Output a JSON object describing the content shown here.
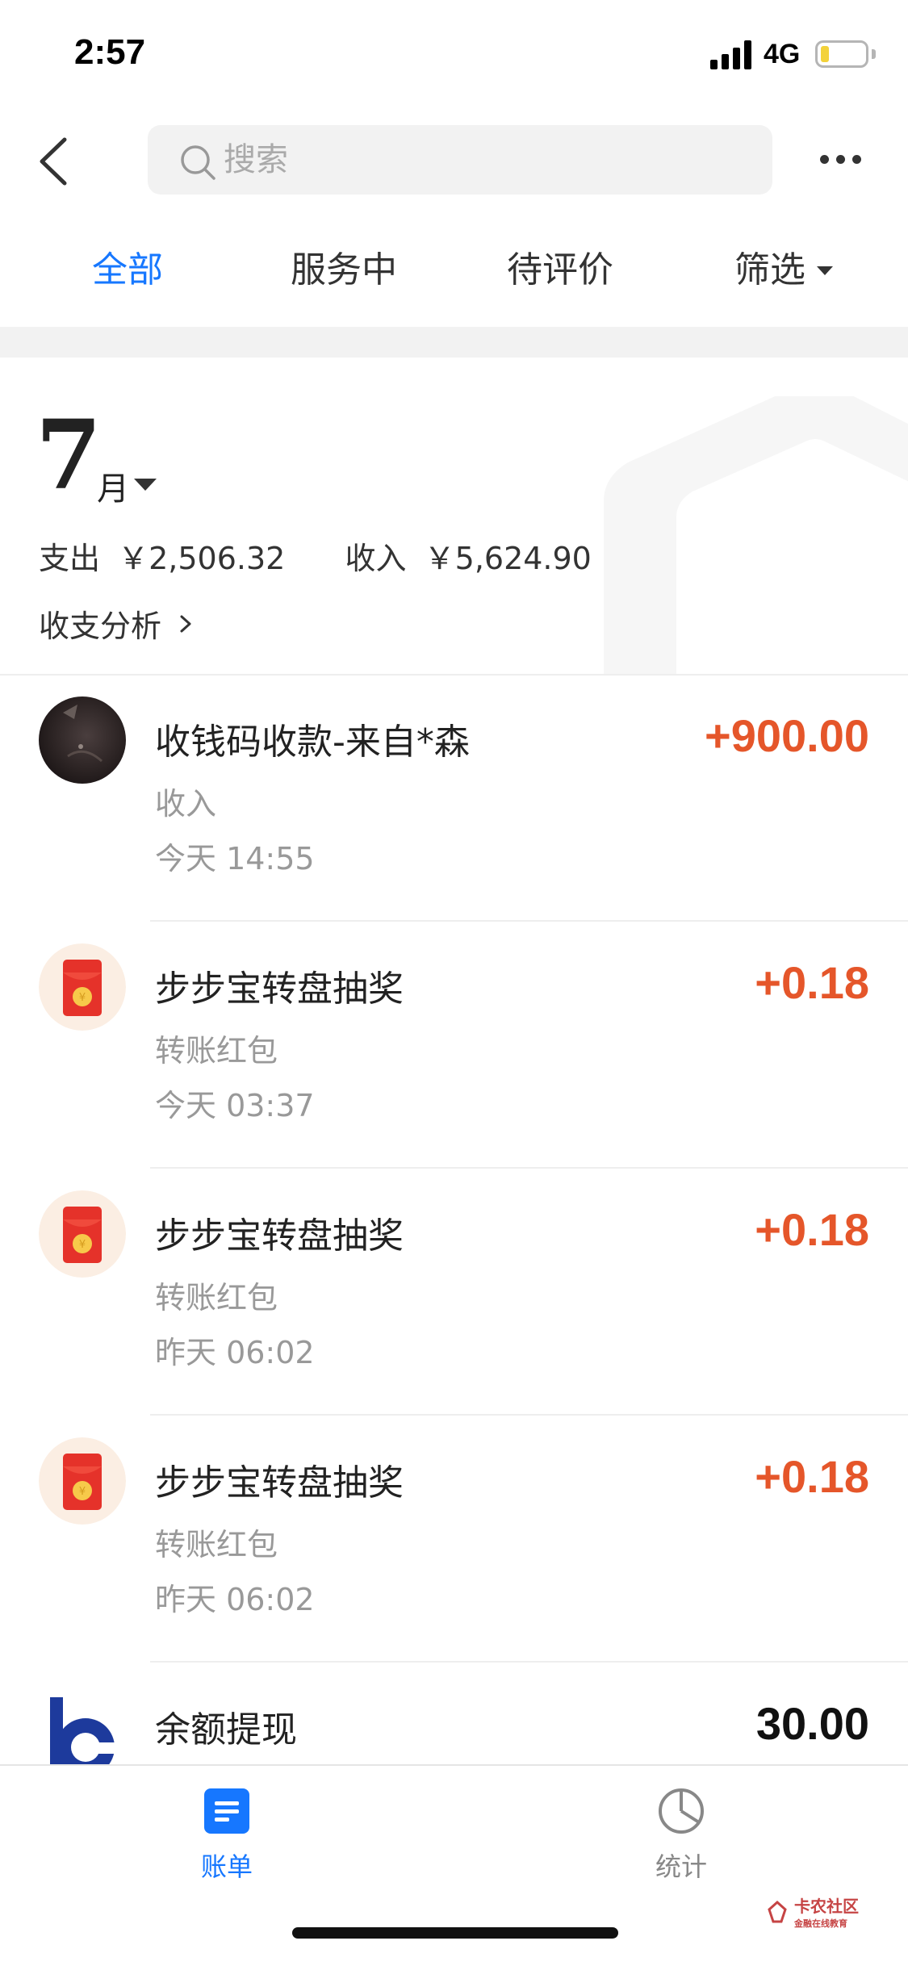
{
  "status_bar": {
    "time": "2:57",
    "network": "4G"
  },
  "nav": {
    "search_placeholder": "搜索"
  },
  "tabs": [
    {
      "label": "全部",
      "active": true
    },
    {
      "label": "服务中",
      "active": false
    },
    {
      "label": "待评价",
      "active": false
    },
    {
      "label": "筛选",
      "active": false
    }
  ],
  "summary": {
    "month": "7",
    "month_unit": "月",
    "expense_label": "支出",
    "expense_value": "￥2,506.32",
    "income_label": "收入",
    "income_value": "￥5,624.90",
    "analysis_label": "收支分析"
  },
  "transactions": [
    {
      "title": "收钱码收款-来自*森",
      "category": "收入",
      "time": "今天  14:55",
      "amount": "+900.00",
      "icon": "user-avatar"
    },
    {
      "title": "步步宝转盘抽奖",
      "category": "转账红包",
      "time": "今天  03:37",
      "amount": "+0.18",
      "icon": "red-envelope-icon"
    },
    {
      "title": "步步宝转盘抽奖",
      "category": "转账红包",
      "time": "昨天  06:02",
      "amount": "+0.18",
      "icon": "red-envelope-icon"
    },
    {
      "title": "步步宝转盘抽奖",
      "category": "转账红包",
      "time": "昨天  06:02",
      "amount": "+0.18",
      "icon": "red-envelope-icon"
    },
    {
      "title": "余额提现",
      "category": "",
      "time": "",
      "amount": "30.00",
      "icon": "bank-logo-icon"
    }
  ],
  "bottom_tabs": [
    {
      "label": "账单",
      "icon": "bill-icon",
      "active": true
    },
    {
      "label": "统计",
      "icon": "pie-chart-icon",
      "active": false
    }
  ],
  "watermark": {
    "name": "卡农社区",
    "sub": "金融在线教育"
  },
  "colors": {
    "accent": "#1677ff",
    "income": "#e5562a"
  }
}
